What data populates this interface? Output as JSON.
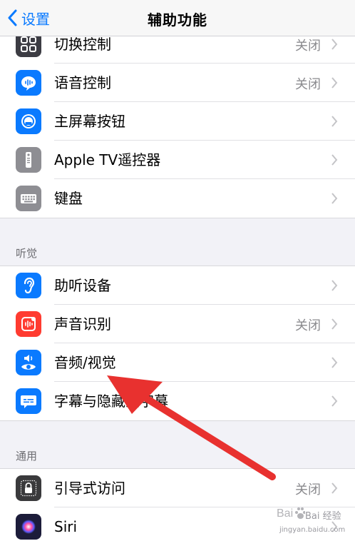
{
  "nav": {
    "back_label": "设置",
    "title": "辅助功能"
  },
  "groups": [
    {
      "rows": [
        {
          "label": "切换控制",
          "value": "关闭",
          "icon": "switch-control-icon",
          "color": "#3c3c43"
        },
        {
          "label": "语音控制",
          "value": "关闭",
          "icon": "voice-control-icon",
          "color": "#0a7aff"
        },
        {
          "label": "主屏幕按钮",
          "value": "",
          "icon": "home-button-icon",
          "color": "#0a7aff"
        },
        {
          "label": "Apple TV遥控器",
          "value": "",
          "icon": "remote-icon",
          "color": "#8e8e93"
        },
        {
          "label": "键盘",
          "value": "",
          "icon": "keyboard-icon",
          "color": "#8e8e93"
        }
      ]
    },
    {
      "header": "听觉",
      "rows": [
        {
          "label": "助听设备",
          "value": "",
          "icon": "ear-icon",
          "color": "#0a7aff"
        },
        {
          "label": "声音识别",
          "value": "关闭",
          "icon": "sound-recognition-icon",
          "color": "#ff3b30"
        },
        {
          "label": "音频/视觉",
          "value": "",
          "icon": "audio-visual-icon",
          "color": "#0a7aff"
        },
        {
          "label": "字幕与隐藏式字幕",
          "value": "",
          "icon": "subtitles-icon",
          "color": "#0a7aff"
        }
      ]
    },
    {
      "header": "通用",
      "rows": [
        {
          "label": "引导式访问",
          "value": "关闭",
          "icon": "lock-icon",
          "color": "#3a3a3c"
        },
        {
          "label": "Siri",
          "value": "",
          "icon": "siri-icon",
          "color": "#1c1c3a"
        }
      ]
    }
  ],
  "watermark": {
    "text": "Bai 经验",
    "url": "jingyan.baidu.com"
  },
  "colors": {
    "accent": "#0a7aff",
    "annotation_arrow": "#e8312f"
  }
}
